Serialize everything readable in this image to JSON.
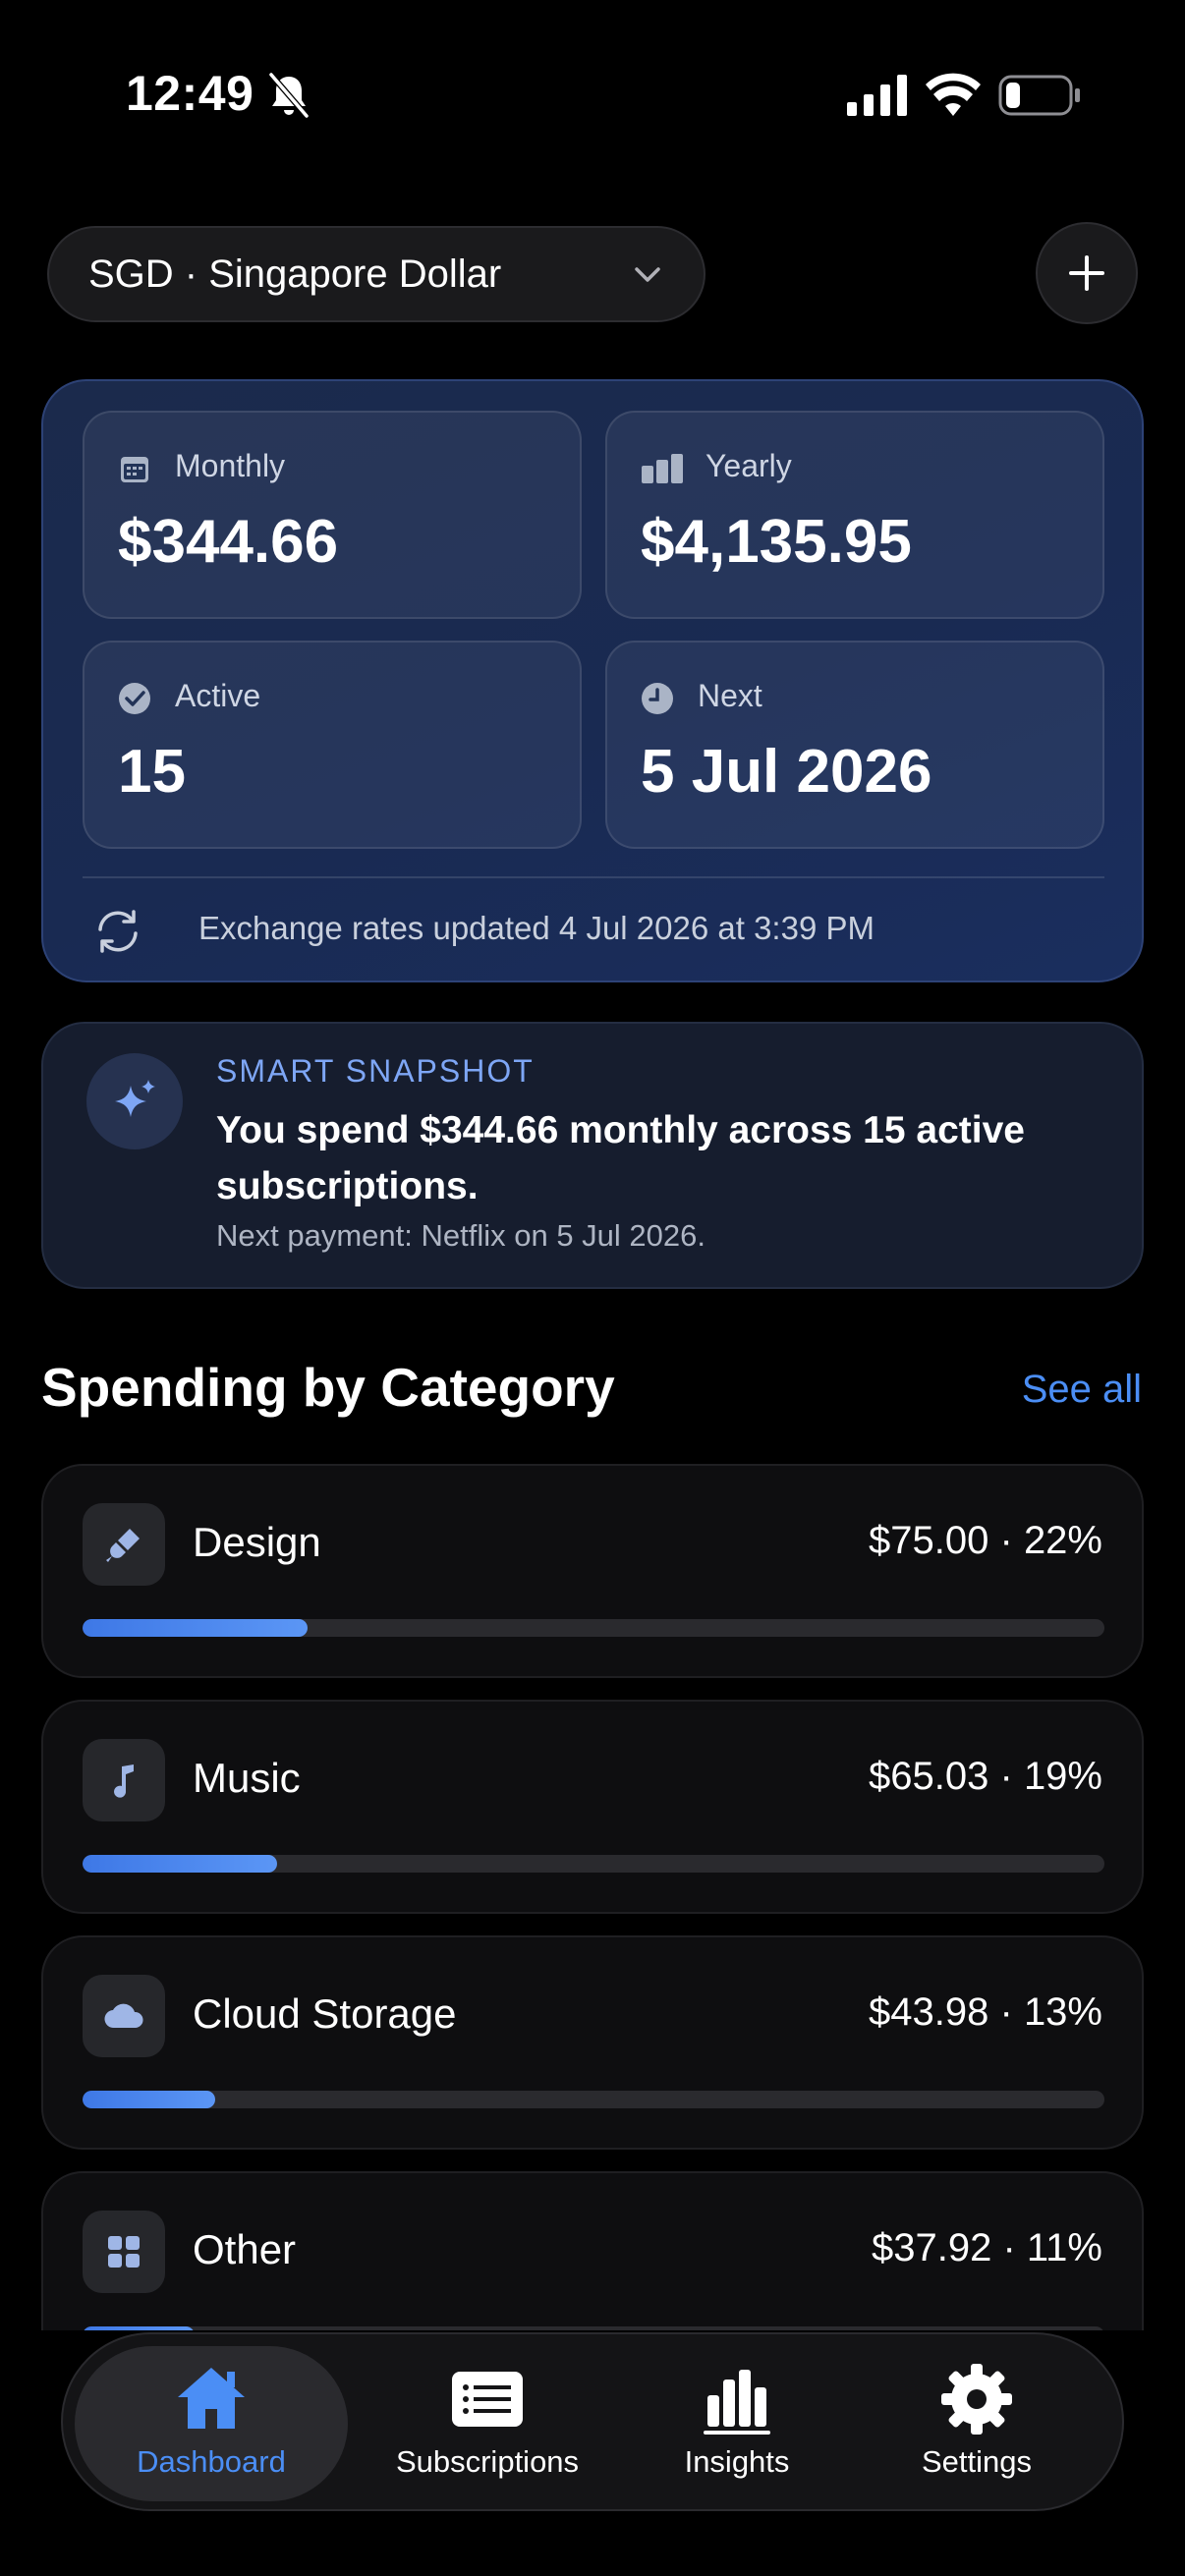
{
  "status_bar": {
    "time": "12:49"
  },
  "currency": {
    "label": "SGD · Singapore Dollar"
  },
  "stats": {
    "monthly": {
      "label": "Monthly",
      "value": "$344.66"
    },
    "yearly": {
      "label": "Yearly",
      "value": "$4,135.95"
    },
    "active": {
      "label": "Active",
      "value": "15"
    },
    "next": {
      "label": "Next",
      "value": "5 Jul 2026"
    }
  },
  "exchange_note": "Exchange rates updated 4 Jul 2026 at 3:39 PM",
  "snapshot": {
    "title": "SMART SNAPSHOT",
    "body": "You spend $344.66 monthly across 15 active subscriptions.",
    "sub": "Next payment: Netflix on 5 Jul 2026."
  },
  "section": {
    "title": "Spending by Category",
    "see_all": "See all"
  },
  "categories": [
    {
      "name": "Design",
      "amount": "$75.00 · 22%",
      "share": 0.22,
      "icon": "paintbrush-icon"
    },
    {
      "name": "Music",
      "amount": "$65.03 · 19%",
      "share": 0.19,
      "icon": "music-note-icon"
    },
    {
      "name": "Cloud Storage",
      "amount": "$43.98 · 13%",
      "share": 0.13,
      "icon": "cloud-icon"
    },
    {
      "name": "Other",
      "amount": "$37.92 · 11%",
      "share": 0.11,
      "icon": "grid-icon"
    }
  ],
  "tabs": [
    {
      "label": "Dashboard",
      "icon": "house-icon",
      "active": true
    },
    {
      "label": "Subscriptions",
      "icon": "list-icon",
      "active": false
    },
    {
      "label": "Insights",
      "icon": "bar-chart-icon",
      "active": false
    },
    {
      "label": "Settings",
      "icon": "gear-icon",
      "active": false
    }
  ],
  "colors": {
    "accent": "#4b8ef5",
    "card": "#1b2a4c",
    "background": "#000000"
  }
}
